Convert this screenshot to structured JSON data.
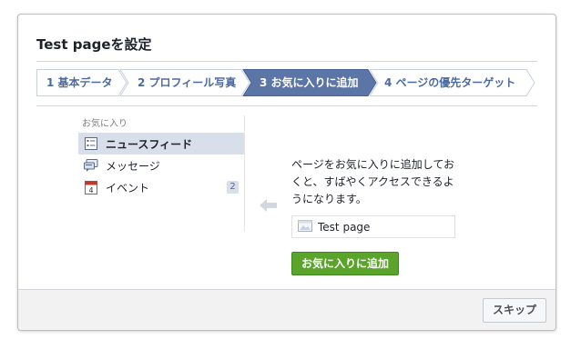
{
  "dialog": {
    "title": "Test pageを設定"
  },
  "steps": [
    {
      "label": "1 基本データ",
      "active": false
    },
    {
      "label": "2 プロフィール写真",
      "active": false
    },
    {
      "label": "3 お気に入りに追加",
      "active": true
    },
    {
      "label": "4 ページの優先ターゲット",
      "active": false
    }
  ],
  "favorites": {
    "header": "お気に入り",
    "items": [
      {
        "label": "ニュースフィード",
        "icon": "news-feed-icon",
        "selected": true
      },
      {
        "label": "メッセージ",
        "icon": "messages-icon",
        "selected": false
      },
      {
        "label": "イベント",
        "icon": "calendar-icon",
        "selected": false,
        "badge": "2"
      }
    ],
    "calendar_day": "4"
  },
  "panel": {
    "description": "ページをお気に入りに追加しておくと、すばやくアクセスできるようになります。",
    "page_name": "Test page",
    "add_button": "お気に入りに追加"
  },
  "footer": {
    "skip_button": "スキップ"
  },
  "colors": {
    "accent_step": "#5b75a6",
    "add_button": "#5aa42c",
    "selected_row": "#d8dfea"
  }
}
